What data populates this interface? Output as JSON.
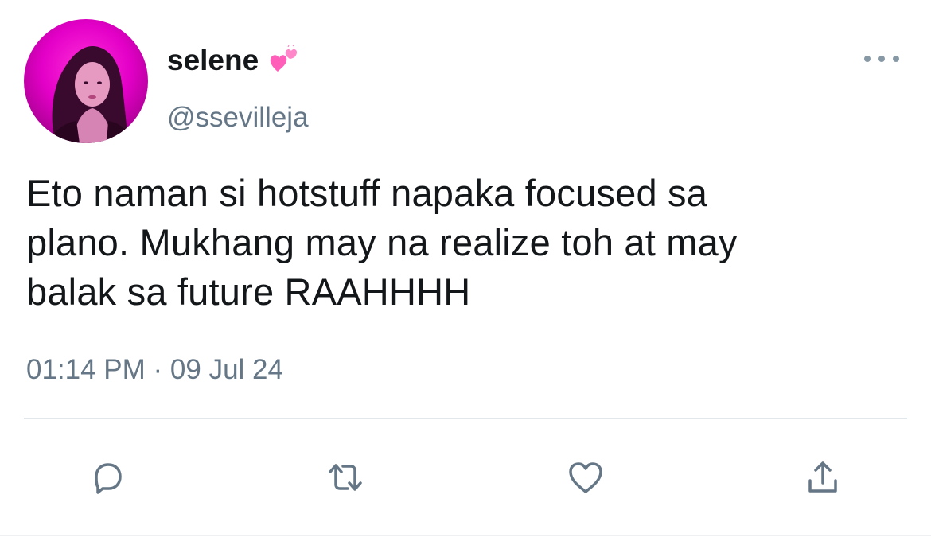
{
  "tweet": {
    "display_name": "selene",
    "name_emoji": "💕",
    "handle": "@ssevilleja",
    "text": "Eto naman si hotstuff napaka focused sa\nplano. Mukhang may na realize toh at may\nbalak sa future RAAHHHH",
    "timestamp": "01:14 PM · 09 Jul 24"
  },
  "icons": {
    "avatar": "profile-photo",
    "more": "more-options-icon",
    "reply": "reply-icon",
    "retweet": "retweet-icon",
    "like": "heart-icon",
    "share": "share-icon",
    "name_emoji": "two-hearts-icon"
  },
  "colors": {
    "text_primary": "#14171a",
    "text_secondary": "#657786",
    "icon_gray": "#657786",
    "divider": "#e1e8ed",
    "avatar_accent": "#e400c8",
    "emoji_pink": "#ff5fb8"
  }
}
